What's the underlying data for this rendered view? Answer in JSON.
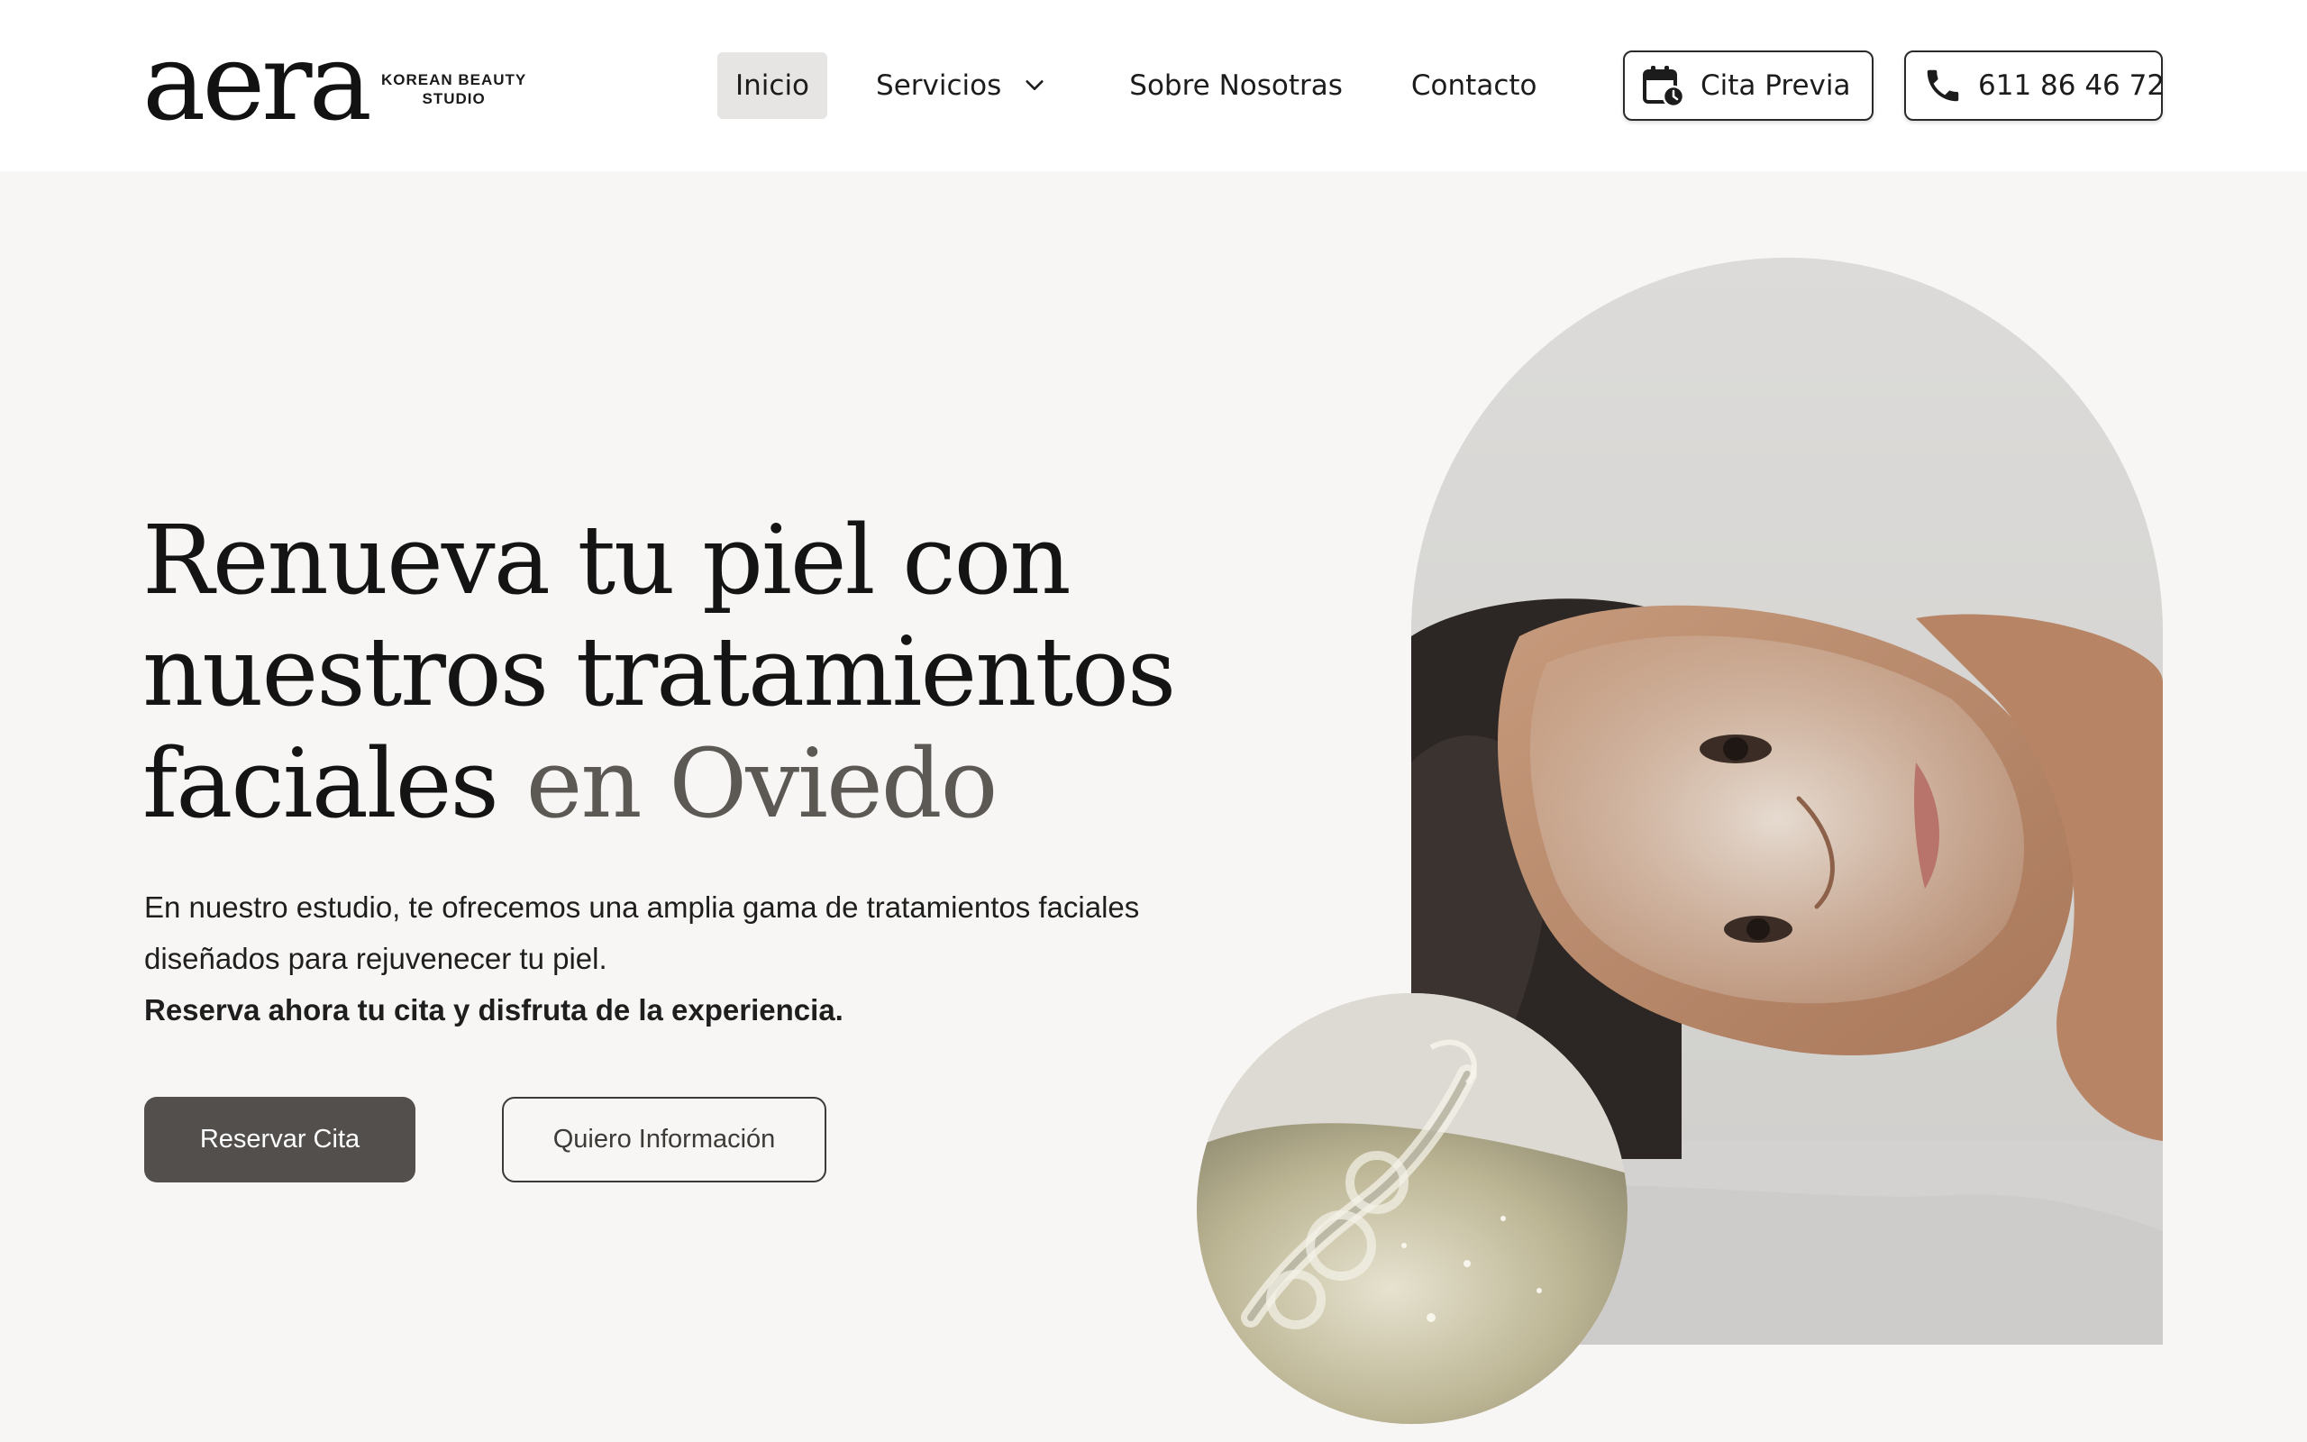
{
  "brand": {
    "name": "aera",
    "subtitle_line1": "KOREAN BEAUTY",
    "subtitle_line2": "STUDIO"
  },
  "nav": {
    "items": [
      {
        "label": "Inicio",
        "active": true
      },
      {
        "label": "Servicios",
        "has_dropdown": true
      },
      {
        "label": "Sobre Nosotras"
      },
      {
        "label": "Contacto"
      }
    ]
  },
  "header_actions": {
    "appointment_label": "Cita Previa",
    "appointment_icon": "calendar-clock-icon",
    "phone_label": "611 86 46 72",
    "phone_icon": "phone-icon"
  },
  "hero": {
    "title_line1": "Renueva tu piel con",
    "title_line2": "nuestros tratamientos",
    "title_line3_main": "faciales",
    "title_line3_muted": " en Oviedo",
    "description": "En nuestro estudio, te ofrecemos una amplia gama de tratamientos faciales diseñados para rejuvenecer tu piel.",
    "description_strong": "Reserva ahora tu cita y disfruta de la experiencia.",
    "primary_button": "Reservar Cita",
    "secondary_button": "Quiero Información"
  },
  "colors": {
    "page_background": "#f7f6f4",
    "header_background": "#ffffff",
    "primary_button": "#534f4c",
    "muted_title": "#5c5955",
    "active_nav": "#e6e5e3"
  }
}
